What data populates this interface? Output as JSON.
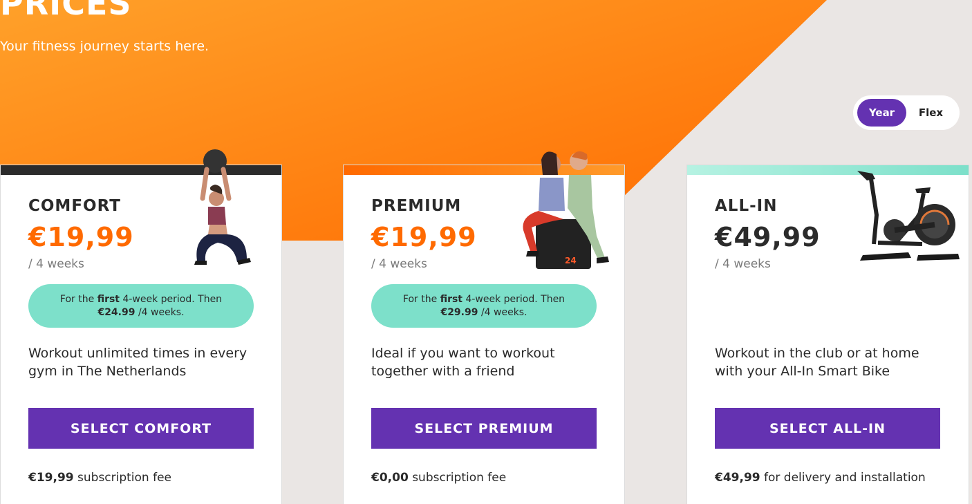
{
  "hero": {
    "title": "PRICES",
    "subtitle": "Your fitness journey starts here."
  },
  "toggle": {
    "options": [
      "Year",
      "Flex"
    ],
    "selected": "Year"
  },
  "plans": [
    {
      "name": "COMFORT",
      "price": "€19,99",
      "period": "/ 4 weeks",
      "promo": {
        "pre": "For the",
        "bold": "first",
        "post": "4-week period. Then",
        "then_price": "€24.99",
        "then_suffix": "/4 weeks."
      },
      "description": "Workout unlimited times in every gym in The Netherlands",
      "cta": "SELECT COMFORT",
      "fee_amount": "€19,99",
      "fee_text": "subscription fee",
      "image": "woman-with-medicine-ball"
    },
    {
      "name": "PREMIUM",
      "price": "€19,99",
      "period": "/ 4 weeks",
      "promo": {
        "pre": "For the",
        "bold": "first",
        "post": "4-week period. Then",
        "then_price": "€29.99",
        "then_suffix": "/4 weeks."
      },
      "description": "Ideal if you want to workout together with a friend",
      "cta": "SELECT PREMIUM",
      "fee_amount": "€0,00",
      "fee_text": "subscription fee",
      "image": "two-women-sitting-on-box",
      "box_label": "24"
    },
    {
      "name": "ALL-IN",
      "price": "€49,99",
      "period": "/ 4 weeks",
      "description": "Workout in the club or at home with your All-In Smart Bike",
      "cta": "SELECT ALL-IN",
      "fee_amount": "€49,99",
      "fee_text": "for delivery and installation",
      "image": "smart-bike"
    }
  ],
  "colors": {
    "orange": "#ff6a00",
    "purple": "#6432b1",
    "mint": "#7de0ca",
    "dark": "#2b2b2b",
    "background": "#eae6e4"
  }
}
